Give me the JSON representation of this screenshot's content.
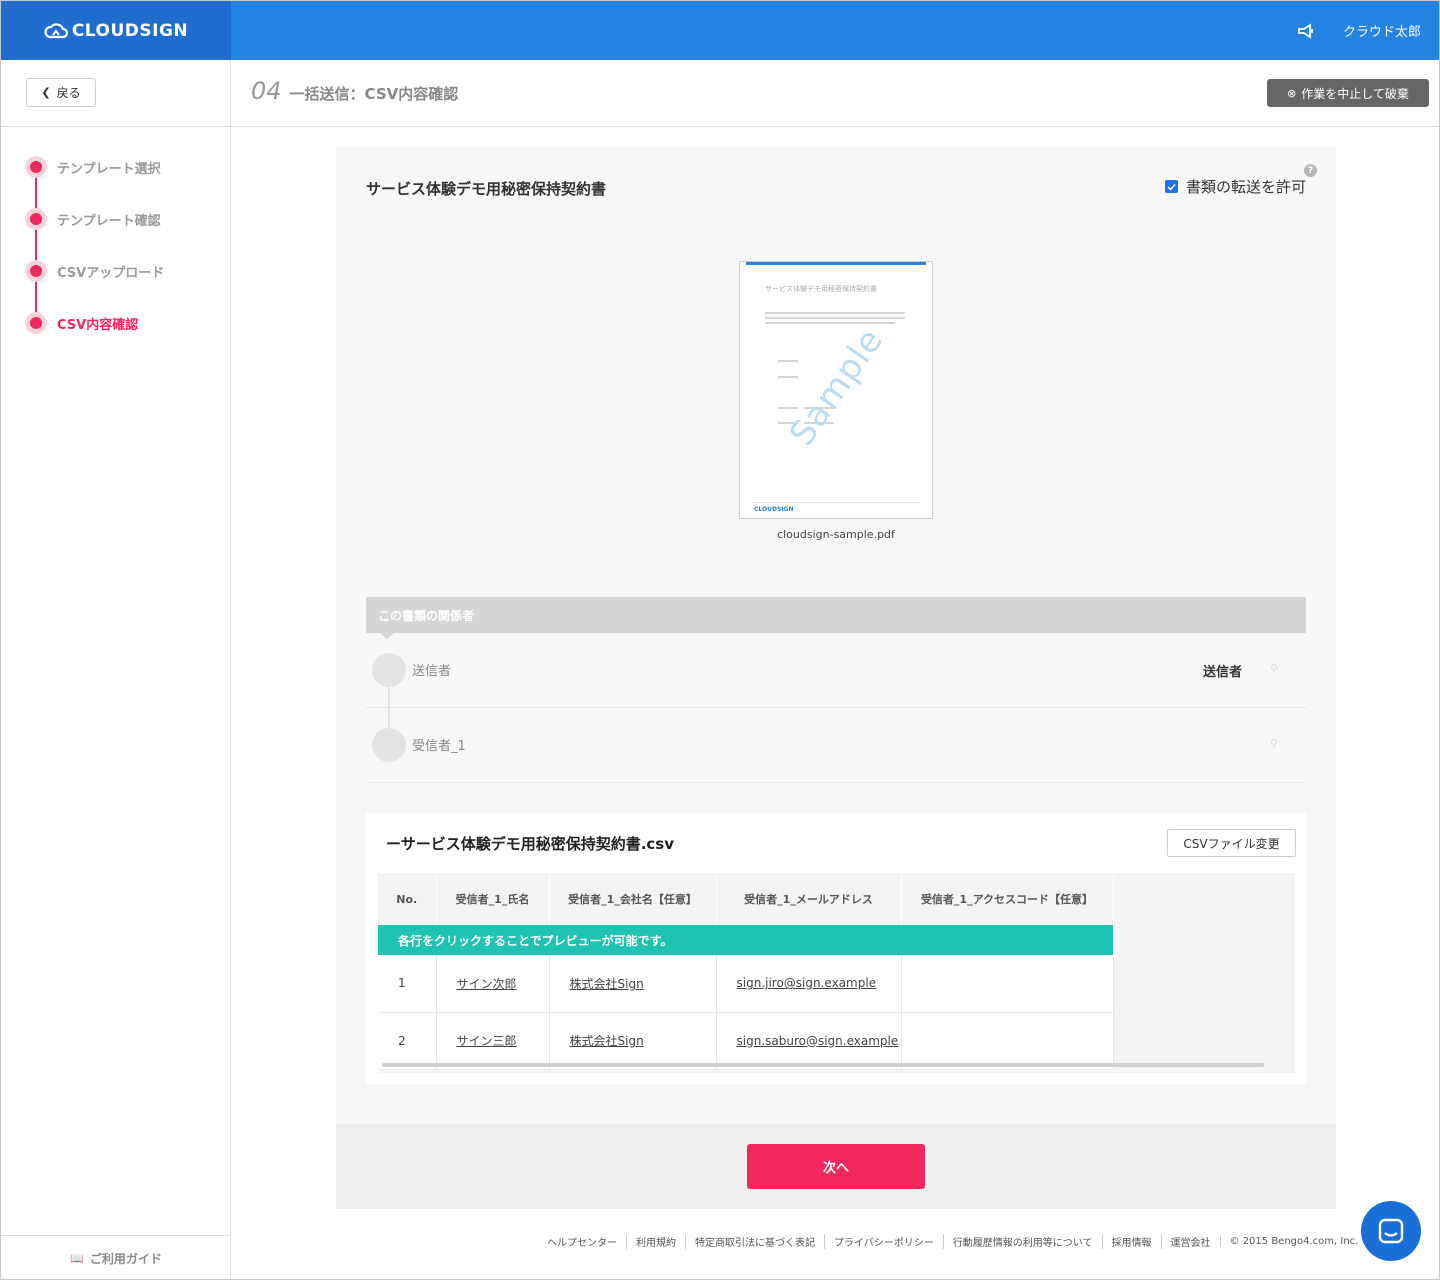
{
  "header": {
    "logo": "CLOUDSIGN",
    "user_name": "クラウド太郎",
    "notification_icon": "megaphone-icon"
  },
  "subheader": {
    "back_label": "戻る",
    "step_number": "04",
    "step_title": "一括送信：CSV内容確認",
    "cancel_label": "作業を中止して破棄"
  },
  "sidebar": {
    "steps": [
      {
        "label": "テンプレート選択",
        "active": false
      },
      {
        "label": "テンプレート確認",
        "active": false
      },
      {
        "label": "CSVアップロード",
        "active": false
      },
      {
        "label": "CSV内容確認",
        "active": true
      }
    ],
    "guide_label": "ご利用ガイド"
  },
  "document": {
    "title": "サービス体験デモ用秘密保持契約書",
    "forward_label": "書類の転送を許可",
    "forward_checked": true,
    "help": "?",
    "thumbnail_title": "サービス体験デモ用秘密保持契約書",
    "thumbnail_watermark": "Sample",
    "thumbnail_logo": "CLOUDSIGN",
    "file_name": "cloudsign-sample.pdf"
  },
  "parties": {
    "header": "この書類の関係者",
    "items": [
      {
        "name": "送信者",
        "role": "送信者"
      },
      {
        "name": "受信者_1",
        "role": ""
      }
    ]
  },
  "csv": {
    "title": "ーサービス体験デモ用秘密保持契約書.csv",
    "change_label": "CSVファイル変更",
    "columns": [
      "No.",
      "受信者_1_氏名",
      "受信者_1_会社名【任意】",
      "受信者_1_メールアドレス",
      "受信者_1_アクセスコード【任意】"
    ],
    "hint": "各行をクリックすることでプレビューが可能です。",
    "rows": [
      [
        "1",
        "サイン次郎",
        "株式会社Sign",
        "sign.jiro@sign.example",
        ""
      ],
      [
        "2",
        "サイン三郎",
        "株式会社Sign",
        "sign.saburo@sign.example",
        ""
      ]
    ]
  },
  "next_label": "次へ",
  "footer": {
    "links": [
      "ヘルプセンター",
      "利用規約",
      "特定商取引法に基づく表記",
      "プライバシーポリシー",
      "行動履歴情報の利用等について",
      "採用情報",
      "運営会社"
    ],
    "copyright": "© 2015 Bengo4.com, Inc."
  },
  "colors": {
    "brand_blue": "#2584e2",
    "accent_pink": "#f0285d",
    "hint_teal": "#1ec3b4"
  }
}
